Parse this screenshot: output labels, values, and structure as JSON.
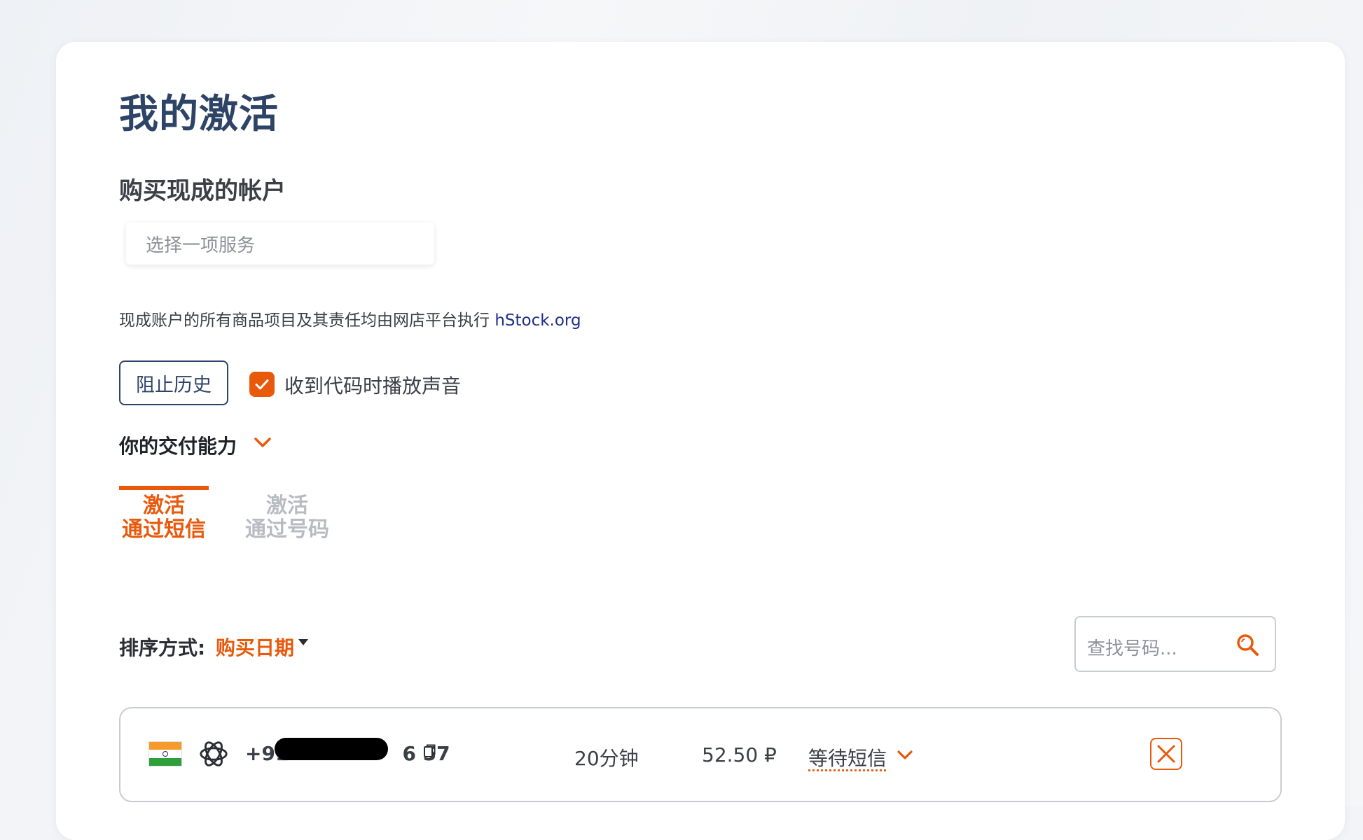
{
  "page": {
    "title": "我的激活",
    "section_title": "购买现成的帐户",
    "service_select_placeholder": "选择一项服务",
    "notice_text": "现成账户的所有商品项目及其责任均由网店平台执行 ",
    "notice_link": "hStock.org"
  },
  "controls": {
    "block_history_label": "阻止历史",
    "sound_on_code_label": "收到代码时播放声音",
    "sound_on_code_checked": true,
    "payment_label": "你的交付能力"
  },
  "tabs": [
    {
      "label": "激活\n通过短信",
      "active": true
    },
    {
      "label": "激活\n通过号码",
      "active": false
    }
  ],
  "sort": {
    "label": "排序方式:",
    "value": "购买日期"
  },
  "search": {
    "placeholder": "查找号码..."
  },
  "activations": [
    {
      "country_flag": "india-flag",
      "service_icon": "openai-icon",
      "phone_prefix": "+91",
      "phone_suffix": "6 57",
      "duration": "20分钟",
      "price": "52.50 ₽",
      "status": "等待短信"
    }
  ],
  "colors": {
    "accent": "#e8590c",
    "title": "#2e4466",
    "border": "#c8ccd2"
  }
}
